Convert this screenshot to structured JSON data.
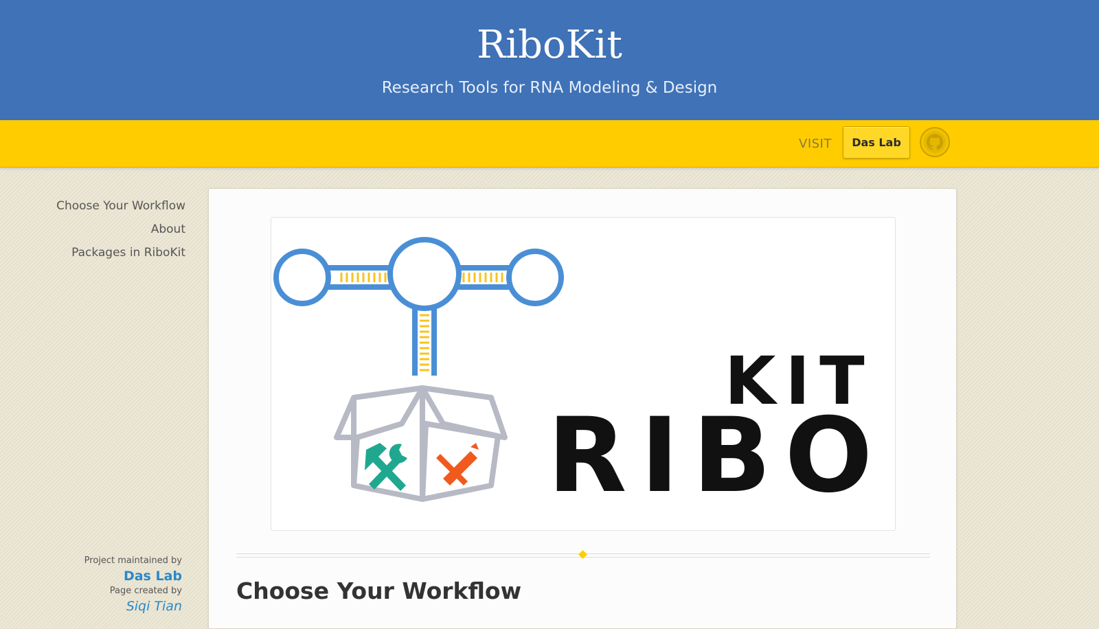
{
  "header": {
    "title": "RiboKit",
    "tagline": "Research Tools for RNA Modeling & Design"
  },
  "banner": {
    "visit_label": "VISIT",
    "das_lab_button": "Das Lab"
  },
  "sidebar": {
    "items": [
      {
        "label": "Choose Your Workflow"
      },
      {
        "label": "About"
      },
      {
        "label": "Packages in RiboKit"
      }
    ]
  },
  "credits": {
    "maintained_label": "Project maintained by",
    "maintainer": "Das Lab",
    "created_label": "Page created by",
    "creator": "Siqi Tian"
  },
  "logo": {
    "word_top": "KIT",
    "word_bottom": "RIBO"
  },
  "main": {
    "heading": "Choose Your Workflow"
  },
  "colors": {
    "header_blue": "#3f72b7",
    "banner_yellow": "#ffcc00",
    "rna_blue": "#4a8fd6",
    "rna_yellow": "#f7c41d",
    "box_gray": "#b7b9c4",
    "tool_teal": "#1fa88f",
    "tool_orange": "#f05a1e",
    "link_blue": "#2b88c8"
  }
}
